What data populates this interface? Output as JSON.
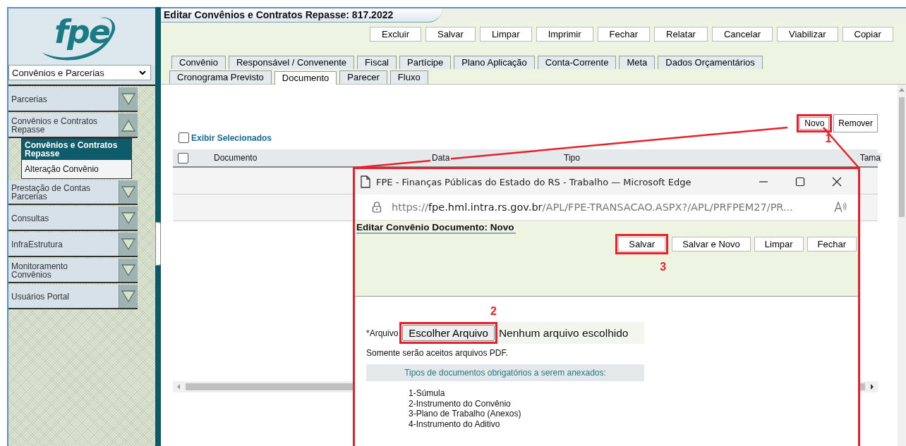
{
  "sidebar": {
    "logo_text": "fpe",
    "module_select": "Convênios e Parcerias",
    "items": [
      {
        "label": "Parcerias",
        "expanded": false
      },
      {
        "label": "Convênios e Contratos Repasse",
        "expanded": true,
        "children": [
          {
            "label": "Convênios e Contratos Repasse",
            "selected": true
          },
          {
            "label": "Alteração Convênio",
            "selected": false
          }
        ]
      },
      {
        "label": "Prestação de Contas Parcerias",
        "expanded": false
      },
      {
        "label": "Consultas",
        "expanded": false
      },
      {
        "label": "InfraEstrutura",
        "expanded": false
      },
      {
        "label": "Monitoramento Convênios",
        "expanded": false
      },
      {
        "label": "Usuários Portal",
        "expanded": false
      }
    ]
  },
  "page": {
    "title": "Editar Convênios e Contratos Repasse: 817.2022",
    "buttons": [
      "Excluir",
      "Salvar",
      "Limpar",
      "Imprimir",
      "Fechar",
      "Relatar",
      "Cancelar",
      "Viabilizar",
      "Copiar"
    ],
    "tabs_row_1": [
      {
        "label": "Convênio",
        "selected": false
      },
      {
        "label": "Responsável / Convenente",
        "selected": false
      },
      {
        "label": "Fiscal",
        "selected": false
      },
      {
        "label": "Partícipe",
        "selected": false
      },
      {
        "label": "Plano Aplicação",
        "selected": false
      },
      {
        "label": "Conta-Corrente",
        "selected": false
      },
      {
        "label": "Meta",
        "selected": false
      },
      {
        "label": "Dados Orçamentários",
        "selected": false
      }
    ],
    "tabs_row_2": [
      {
        "label": "Cronograma Previsto",
        "selected": false
      },
      {
        "label": "Documento",
        "selected": true
      },
      {
        "label": "Parecer",
        "selected": false
      },
      {
        "label": "Fluxo",
        "selected": false
      }
    ],
    "document_buttons": [
      {
        "label": "Novo",
        "highlighted": true,
        "callout": "1"
      },
      {
        "label": "Remover",
        "highlighted": false
      }
    ],
    "show_selected": {
      "label": "Exibir Selecionados",
      "checked": false
    },
    "table": {
      "select_all_checked": false,
      "columns": [
        "Documento",
        "Data",
        "Tipo",
        "Tama"
      ]
    }
  },
  "popup": {
    "title": "FPE - Finanças Públicas do Estado do RS - Trabalho — Microsoft Edge",
    "url": "https://**fpe.hml.intra.rs.gov.br**/APL/FPE-TRANSACAO.ASPX?/APL/PRFPEM27/PR...",
    "heading": "Editar Convênio Documento: Novo",
    "buttons": [
      {
        "label": "Salvar",
        "highlighted": true,
        "callout": "3"
      },
      {
        "label": "Salvar e Novo",
        "highlighted": false
      },
      {
        "label": "Limpar",
        "highlighted": false
      },
      {
        "label": "Fechar",
        "highlighted": false
      }
    ],
    "file_label": "*Arquivo",
    "file_button": {
      "label": "Escolher Arquivo",
      "highlighted": true,
      "callout": "2"
    },
    "file_status": "Nenhum arquivo escolhido",
    "note": "Somente serão aceitos arquivos PDF.",
    "required_title": "Tipos de documentos obrigatórios a serem anexados:",
    "required_list": [
      "1-Súmula",
      "2-Instrumento do Convênio",
      "3-Plano de Trabalho (Anexos)",
      "4-Instrumento do Aditivo"
    ]
  }
}
